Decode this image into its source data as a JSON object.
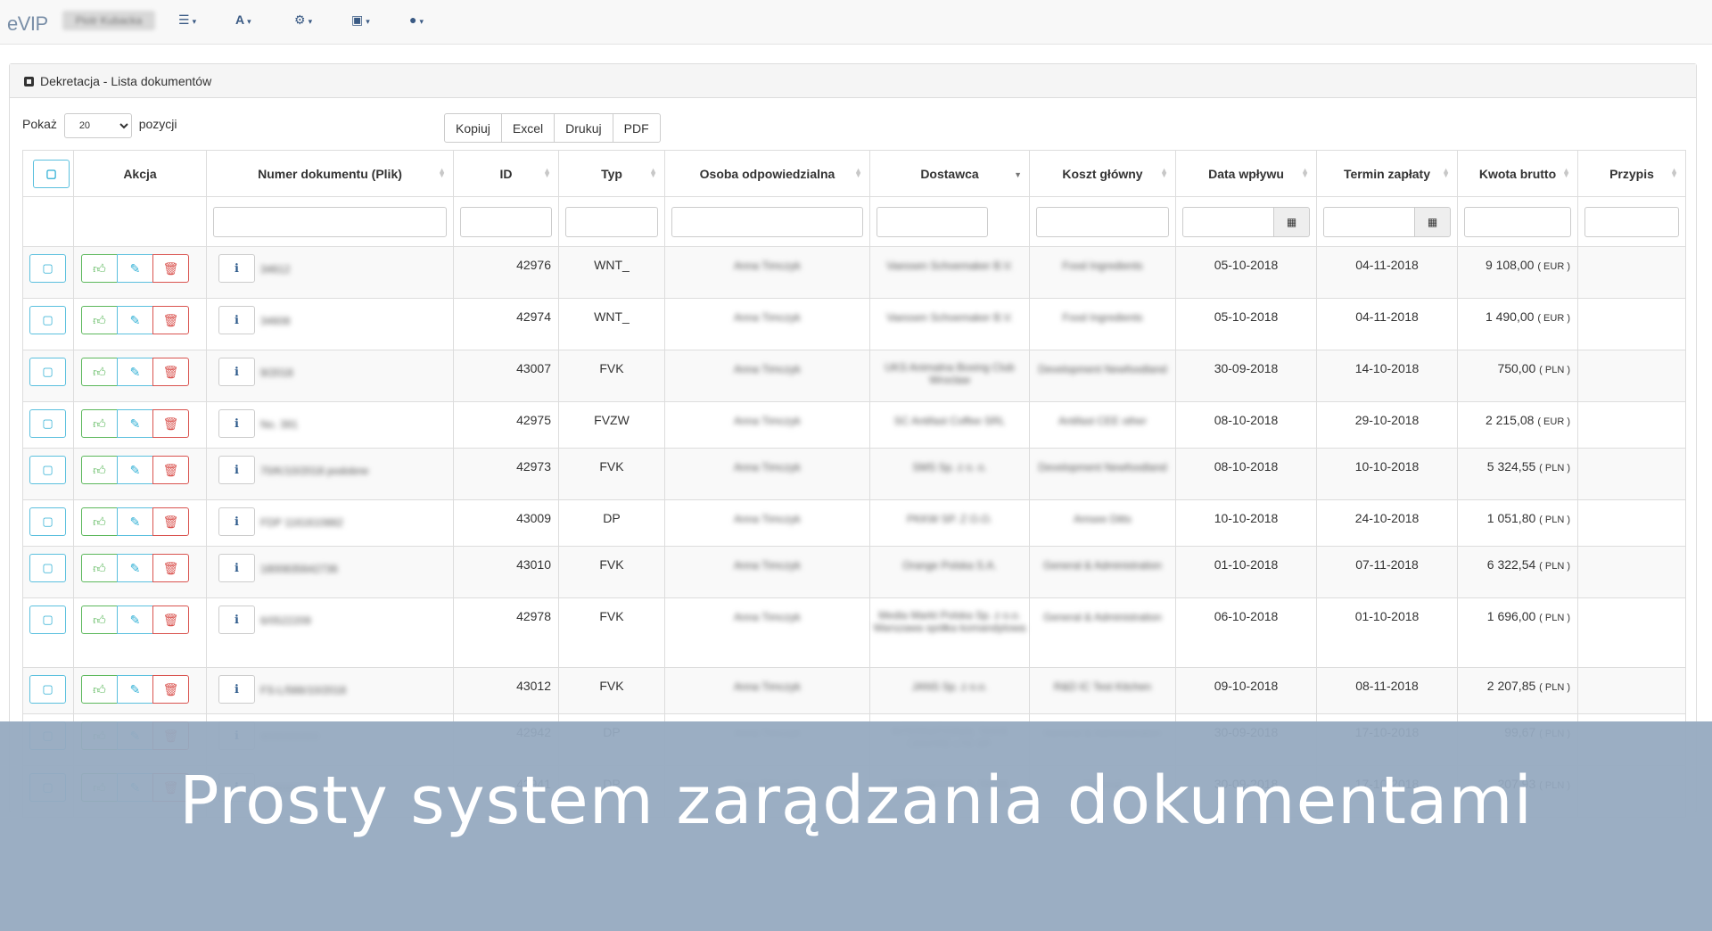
{
  "app": {
    "logo": "eVIP",
    "user": "Piotr Kubacka"
  },
  "nav": [
    {
      "icon": "list-icon"
    },
    {
      "icon": "font-icon"
    },
    {
      "icon": "gear-icon"
    },
    {
      "icon": "language-icon"
    },
    {
      "icon": "user-icon"
    }
  ],
  "panel": {
    "title": "Dekretacja - Lista dokumentów"
  },
  "show": {
    "prefix": "Pokaż",
    "value": "20",
    "suffix": "pozycji"
  },
  "buttons": {
    "copy": "Kopiuj",
    "excel": "Excel",
    "print": "Drukuj",
    "pdf": "PDF"
  },
  "columns": {
    "action": "Akcja",
    "doc": "Numer dokumentu (Plik)",
    "id": "ID",
    "type": "Typ",
    "person": "Osoba odpowiedzialna",
    "supplier": "Dostawca",
    "cost": "Koszt główny",
    "date_in": "Data wpływu",
    "due": "Termin zapłaty",
    "gross": "Kwota brutto",
    "assign": "Przypis"
  },
  "rows": [
    {
      "doc": "34612",
      "id": "42976",
      "type": "WNT_",
      "person": "Anna Timczyk",
      "supplier": "Vaessen Schoemaker B.V.",
      "cost": "Food Ingredients",
      "date_in": "05-10-2018",
      "due": "04-11-2018",
      "amount": "9 108,00",
      "cur": "( EUR )"
    },
    {
      "doc": "34608",
      "id": "42974",
      "type": "WNT_",
      "person": "Anna Timczyk",
      "supplier": "Vaessen Schoemaker B.V.",
      "cost": "Food Ingredients",
      "date_in": "05-10-2018",
      "due": "04-11-2018",
      "amount": "1 490,00",
      "cur": "( EUR )"
    },
    {
      "doc": "9/2018",
      "id": "43007",
      "type": "FVK",
      "person": "Anna Timczyk",
      "supplier": "UKS Animalna Boxing Club Wroclaw",
      "cost": "Development Newfoodland",
      "date_in": "30-09-2018",
      "due": "14-10-2018",
      "amount": "750,00",
      "cur": "( PLN )"
    },
    {
      "doc": "No. 391",
      "id": "42975",
      "type": "FVZW",
      "person": "Anna Timczyk",
      "supplier": "SC Antifast Coffee SRL",
      "cost": "Antifast CEE other",
      "date_in": "08-10-2018",
      "due": "29-10-2018",
      "amount": "2 215,08",
      "cur": "( EUR )"
    },
    {
      "doc": "70/K/10/2018 podobne",
      "id": "42973",
      "type": "FVK",
      "person": "Anna Timczyk",
      "supplier": "SMS Sp. z o. o.",
      "cost": "Development Newfoodland",
      "date_in": "08-10-2018",
      "due": "10-10-2018",
      "amount": "5 324,55",
      "cur": "( PLN )"
    },
    {
      "doc": "FDP 1161610882",
      "id": "43009",
      "type": "DP",
      "person": "Anna Timczyk",
      "supplier": "PKKW SP. Z O.O.",
      "cost": "Amsee Ditts",
      "date_in": "10-10-2018",
      "due": "24-10-2018",
      "amount": "1 051,80",
      "cur": "( PLN )"
    },
    {
      "doc": "1800835642736",
      "id": "43010",
      "type": "FVK",
      "person": "Anna Timczyk",
      "supplier": "Orange Polska S.A.",
      "cost": "General & Administration",
      "date_in": "01-10-2018",
      "due": "07-11-2018",
      "amount": "6 322,54",
      "cur": "( PLN )"
    },
    {
      "doc": "6/0522209",
      "id": "42978",
      "type": "FVK",
      "person": "Anna Timczyk",
      "supplier": "Media Markt Polska Sp. z o.o. Warszawa spółka komandytowa",
      "cost": "General & Administration",
      "date_in": "06-10-2018",
      "due": "01-10-2018",
      "amount": "1 696,00",
      "cur": "( PLN )"
    },
    {
      "doc": "FS-L/566/10/2018",
      "id": "43012",
      "type": "FVK",
      "person": "Anna Timczyk",
      "supplier": "JANS Sp. z o.o.",
      "cost": "R&D IC Test Kitchen",
      "date_in": "09-10-2018",
      "due": "08-11-2018",
      "amount": "2 207,85",
      "cur": "( PLN )"
    },
    {
      "doc": "8000000000",
      "id": "42942",
      "type": "DP",
      "person": "Anna Timczyk",
      "supplier": "INTERNATIONAL TAXIS CENTRE LTD SP.",
      "cost": "General & Administration",
      "date_in": "30-09-2018",
      "due": "17-10-2018",
      "amount": "99,67",
      "cur": "( PLN )"
    },
    {
      "doc": "8000000001",
      "id": "42941",
      "type": "DP",
      "person": "Anna Timczyk",
      "supplier": "INTERNATIONAL TAXIS",
      "cost": "General",
      "date_in": "30-09-2018",
      "due": "17-10-2018",
      "amount": "207,93",
      "cur": "( PLN )"
    }
  ],
  "banner": {
    "text": "Prosty system zarądzania dokumentami"
  }
}
